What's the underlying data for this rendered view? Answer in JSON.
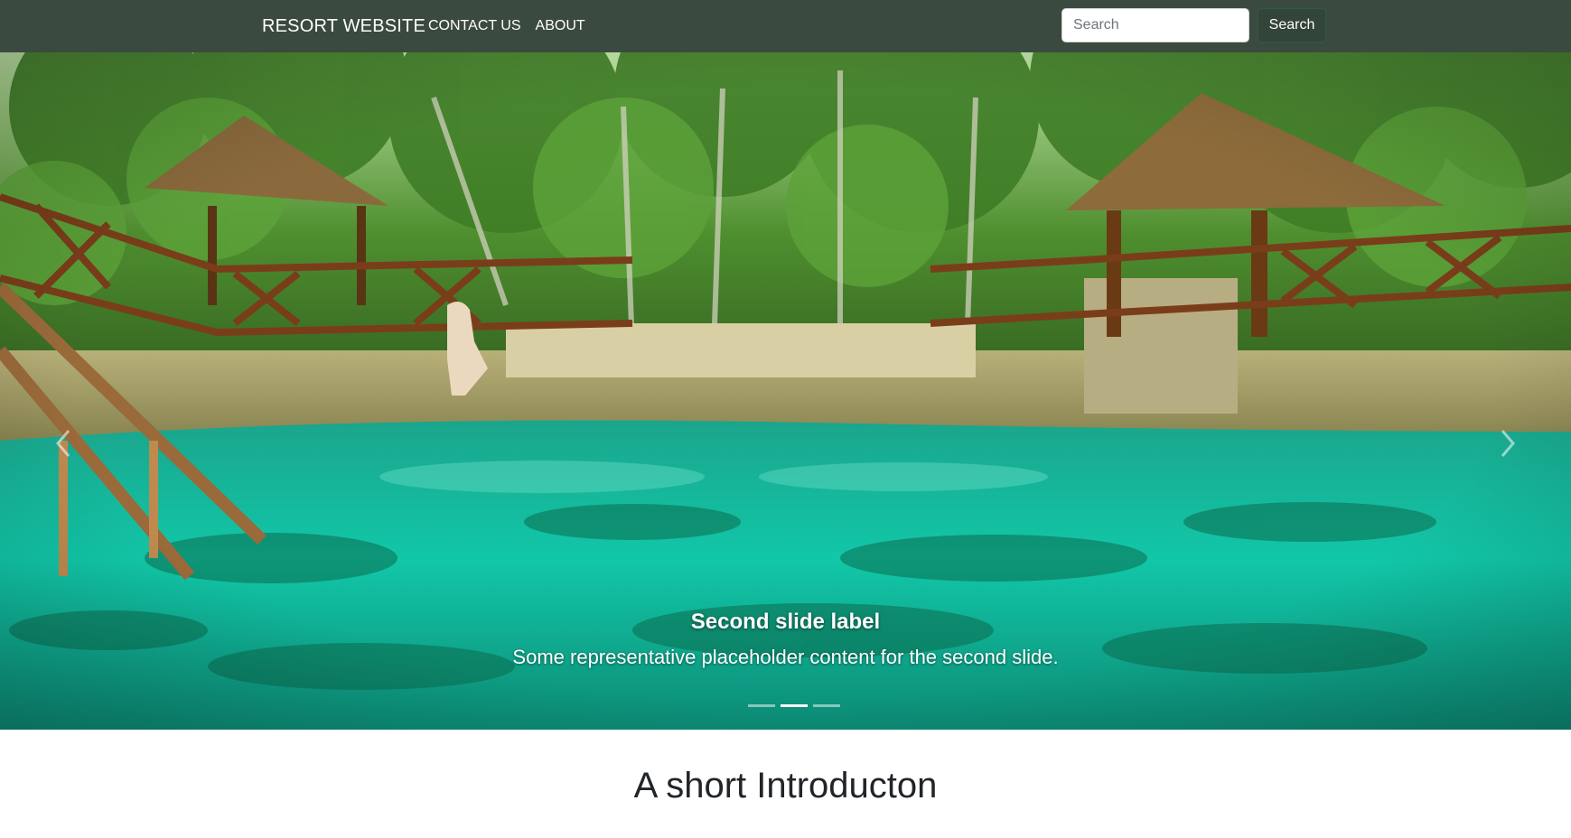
{
  "navbar": {
    "brand": "RESORT WEBSITE",
    "links": [
      "CONTACT US",
      "ABOUT"
    ],
    "search_placeholder": "Search",
    "search_button": "Search",
    "background": "#3b4a3f"
  },
  "carousel": {
    "active_index": 1,
    "slide_count": 3,
    "caption_title": "Second slide label",
    "caption_text": "Some representative placeholder content for the second slide.",
    "prev_icon": "chevron-left-icon",
    "next_icon": "chevron-right-icon"
  },
  "intro": {
    "title": "A short Introducton"
  }
}
